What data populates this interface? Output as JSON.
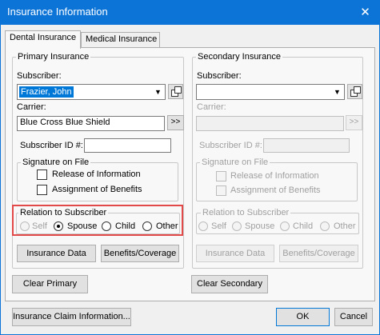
{
  "window": {
    "title": "Insurance Information",
    "close_glyph": "✕"
  },
  "tabs": [
    {
      "label": "Dental Insurance",
      "active": true
    },
    {
      "label": "Medical Insurance",
      "active": false
    }
  ],
  "primary": {
    "group_label": "Primary Insurance",
    "subscriber_label": "Subscriber:",
    "subscriber_value": "Frazier, John",
    "carrier_label": "Carrier:",
    "carrier_value": "Blue Cross Blue Shield",
    "carrier_button": ">>",
    "subscriber_id_label": "Subscriber ID #:",
    "subscriber_id_value": "",
    "signature": {
      "group_label": "Signature on File",
      "release": "Release of Information",
      "assignment": "Assignment of Benefits"
    },
    "relation": {
      "group_label": "Relation to Subscriber",
      "options": [
        "Self",
        "Spouse",
        "Child",
        "Other"
      ],
      "selected": "Spouse"
    },
    "insurance_data_button": "Insurance Data",
    "benefits_button": "Benefits/Coverage",
    "clear_button": "Clear Primary"
  },
  "secondary": {
    "group_label": "Secondary Insurance",
    "subscriber_label": "Subscriber:",
    "subscriber_value": "",
    "carrier_label": "Carrier:",
    "carrier_value": "",
    "carrier_button": ">>",
    "subscriber_id_label": "Subscriber ID #:",
    "subscriber_id_value": "",
    "signature": {
      "group_label": "Signature on File",
      "release": "Release of Information",
      "assignment": "Assignment of Benefits"
    },
    "relation": {
      "group_label": "Relation to Subscriber",
      "options": [
        "Self",
        "Spouse",
        "Child",
        "Other"
      ],
      "selected": ""
    },
    "insurance_data_button": "Insurance Data",
    "benefits_button": "Benefits/Coverage",
    "clear_button": "Clear Secondary"
  },
  "footer": {
    "claim_button": "Insurance Claim Information...",
    "ok_button": "OK",
    "cancel_button": "Cancel"
  },
  "icons": {
    "dropdown": "chevron-down-icon",
    "lookup": "lookup-icon",
    "highlight_color": "#e24a4a"
  }
}
